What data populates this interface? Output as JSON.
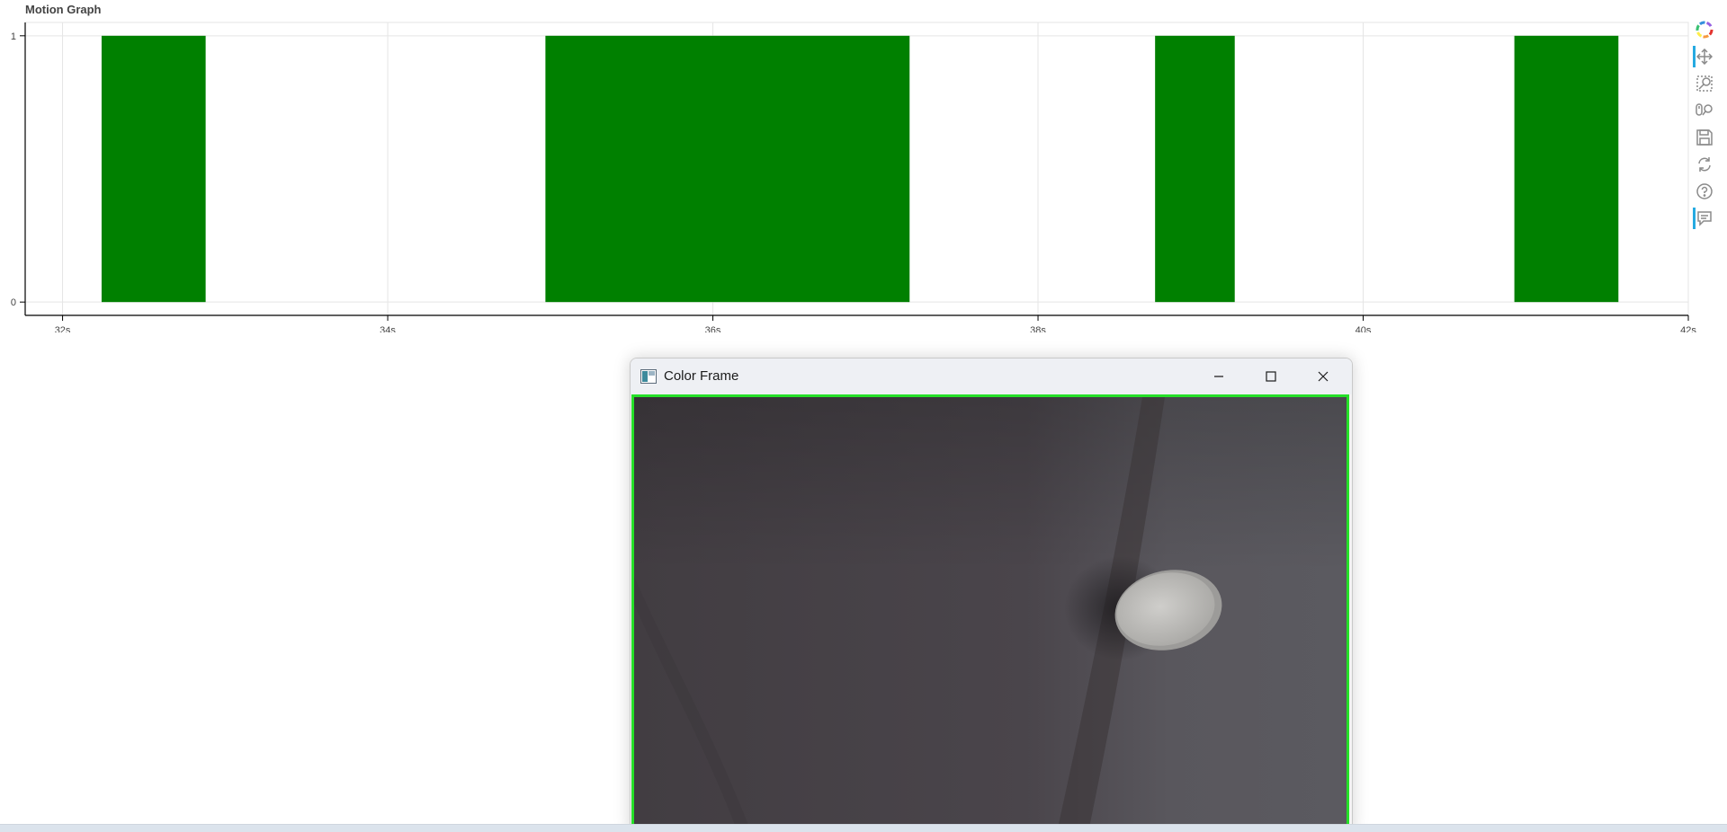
{
  "chart_data": {
    "type": "bar",
    "title": "Motion Graph",
    "xlabel": "",
    "ylabel": "",
    "x_unit": "s",
    "xlim": [
      31.77,
      42.0
    ],
    "ylim": [
      -0.05,
      1.05
    ],
    "x_ticks": [
      32,
      34,
      36,
      38,
      40,
      42
    ],
    "x_tick_labels": [
      "32s",
      "34s",
      "36s",
      "38s",
      "40s",
      "42s"
    ],
    "y_ticks": [
      0,
      1
    ],
    "y_tick_labels": [
      "0",
      "1"
    ],
    "grid": true,
    "color": "#008000",
    "bars": [
      {
        "start": 32.24,
        "end": 32.88,
        "value": 1
      },
      {
        "start": 34.97,
        "end": 37.21,
        "value": 1
      },
      {
        "start": 38.72,
        "end": 39.21,
        "value": 1
      },
      {
        "start": 40.93,
        "end": 41.57,
        "value": 1
      }
    ]
  },
  "toolbar": {
    "tools": [
      {
        "name": "bokeh-logo-icon",
        "active": false
      },
      {
        "name": "pan-icon",
        "active": true
      },
      {
        "name": "box-zoom-icon",
        "active": false
      },
      {
        "name": "wheel-zoom-icon",
        "active": false
      },
      {
        "name": "save-icon",
        "active": false
      },
      {
        "name": "reset-icon",
        "active": false
      },
      {
        "name": "help-icon",
        "active": false
      },
      {
        "name": "hover-icon",
        "active": true
      }
    ],
    "accent_color": "#26aae1"
  },
  "window": {
    "title": "Color Frame",
    "icon": "opencv-window-icon",
    "controls": [
      "minimize-icon",
      "maximize-icon",
      "close-icon"
    ],
    "frame_border_color": "#25e028"
  }
}
